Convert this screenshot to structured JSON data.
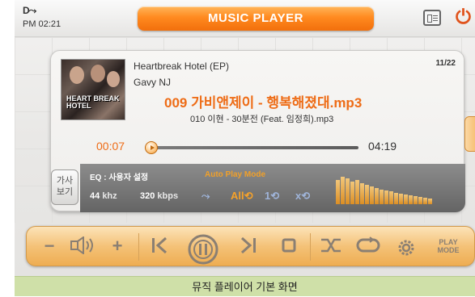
{
  "status": {
    "connection_icon": "D⤳",
    "time": "PM 02:21"
  },
  "header": {
    "title": "MUSIC PLAYER",
    "list_icon": "list-view-icon",
    "power_icon": "power-icon"
  },
  "track": {
    "album_name": "Heartbreak Hotel (EP)",
    "artist": "Gavy NJ",
    "count": "11/22",
    "album_cover_text": "HEART BREAK HOTEL",
    "file_name": "009 가비앤제이 - 행복해졌대.mp3",
    "next_file": "010 이현 - 30분전 (Feat. 임정희).mp3",
    "elapsed": "00:07",
    "duration": "04:19",
    "progress_fraction": 0.03
  },
  "info": {
    "lyrics_label": "가사\n보기",
    "eq": "EQ : 사용자 설정",
    "khz_value": "44",
    "khz_unit": "khz",
    "kbps_value": "320",
    "kbps_unit": "kbps",
    "auto_play_mode": "Auto Play Mode",
    "modes": [
      "⤳",
      "All⟲",
      "1⟲",
      "x⟲"
    ],
    "active_mode": 1
  },
  "controls": {
    "volume_down": "−",
    "volume_up": "+",
    "play_mode_label": "PLAY MODE"
  },
  "caption": "뮤직 플레이어 기본 화면",
  "colors": {
    "accent": "#ee6c16",
    "caption_bg": "#cfe0a8"
  }
}
